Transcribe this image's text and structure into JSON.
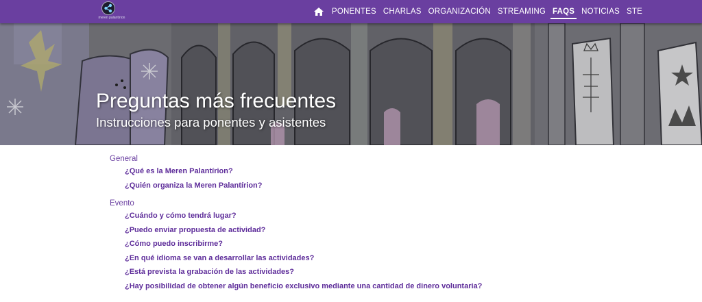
{
  "header": {
    "logo_text": "meren palantírion",
    "nav": [
      {
        "label": "PONENTES"
      },
      {
        "label": "CHARLAS"
      },
      {
        "label": "ORGANIZACIÓN"
      },
      {
        "label": "STREAMING"
      },
      {
        "label": "FAQS",
        "active": true
      },
      {
        "label": "NOTICIAS"
      },
      {
        "label": "STE"
      }
    ],
    "icons": {
      "home": "home-icon",
      "logo": "share-network-icon"
    }
  },
  "hero": {
    "title": "Preguntas más frecuentes",
    "subtitle": "Instrucciones para ponentes y asistentes"
  },
  "faq": {
    "sections": [
      {
        "title": "General",
        "questions": [
          "¿Qué es la Meren Palantírion?",
          "¿Quién organiza la Meren Palantírion?"
        ]
      },
      {
        "title": "Evento",
        "questions": [
          "¿Cuándo y cómo tendrá lugar?",
          "¿Puedo enviar propuesta de actividad?",
          "¿Cómo puedo inscribirme?",
          "¿En qué idioma se van a desarrollar las actividades?",
          "¿Está prevista la grabación de las actividades?",
          "¿Hay posibilidad de obtener algún beneficio exclusivo mediante una cantidad de dinero voluntaria?"
        ]
      }
    ]
  },
  "colors": {
    "brand": "#6a3fa0",
    "link": "#5e2d9a",
    "text_on_brand": "#ffffff"
  }
}
